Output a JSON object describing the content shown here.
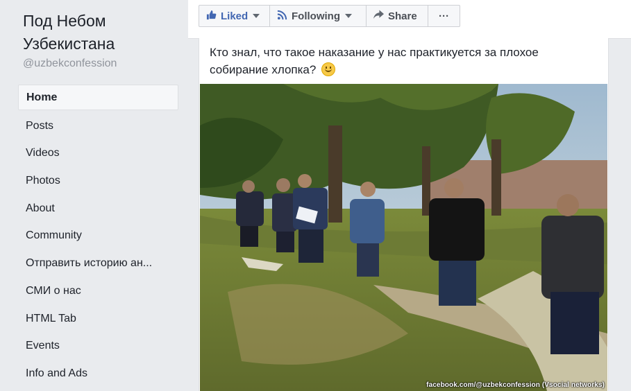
{
  "sidebar": {
    "page_name": "Под Небом Узбекистана",
    "handle": "@uzbekconfession",
    "items": [
      {
        "label": "Home",
        "active": true
      },
      {
        "label": "Posts"
      },
      {
        "label": "Videos"
      },
      {
        "label": "Photos"
      },
      {
        "label": "About"
      },
      {
        "label": "Community"
      },
      {
        "label": "Отправить историю ан..."
      },
      {
        "label": "СМИ о нас"
      },
      {
        "label": "HTML Tab"
      },
      {
        "label": "Events"
      },
      {
        "label": "Info and Ads"
      }
    ]
  },
  "actions": {
    "liked_label": "Liked",
    "following_label": "Following",
    "share_label": "Share",
    "more_label": "···",
    "liked_icon": "thumbs-up-icon",
    "following_icon": "rss-icon",
    "share_icon": "share-arrow-icon",
    "accent": "#4267b2"
  },
  "post": {
    "text": "Кто знал, что такое наказание у нас практикуется за плохое собирание хлопка?",
    "emoji": "smiley-icon"
  },
  "photo": {
    "credit": "facebook.com/@uzbekconfession (Vsocial networks)"
  }
}
